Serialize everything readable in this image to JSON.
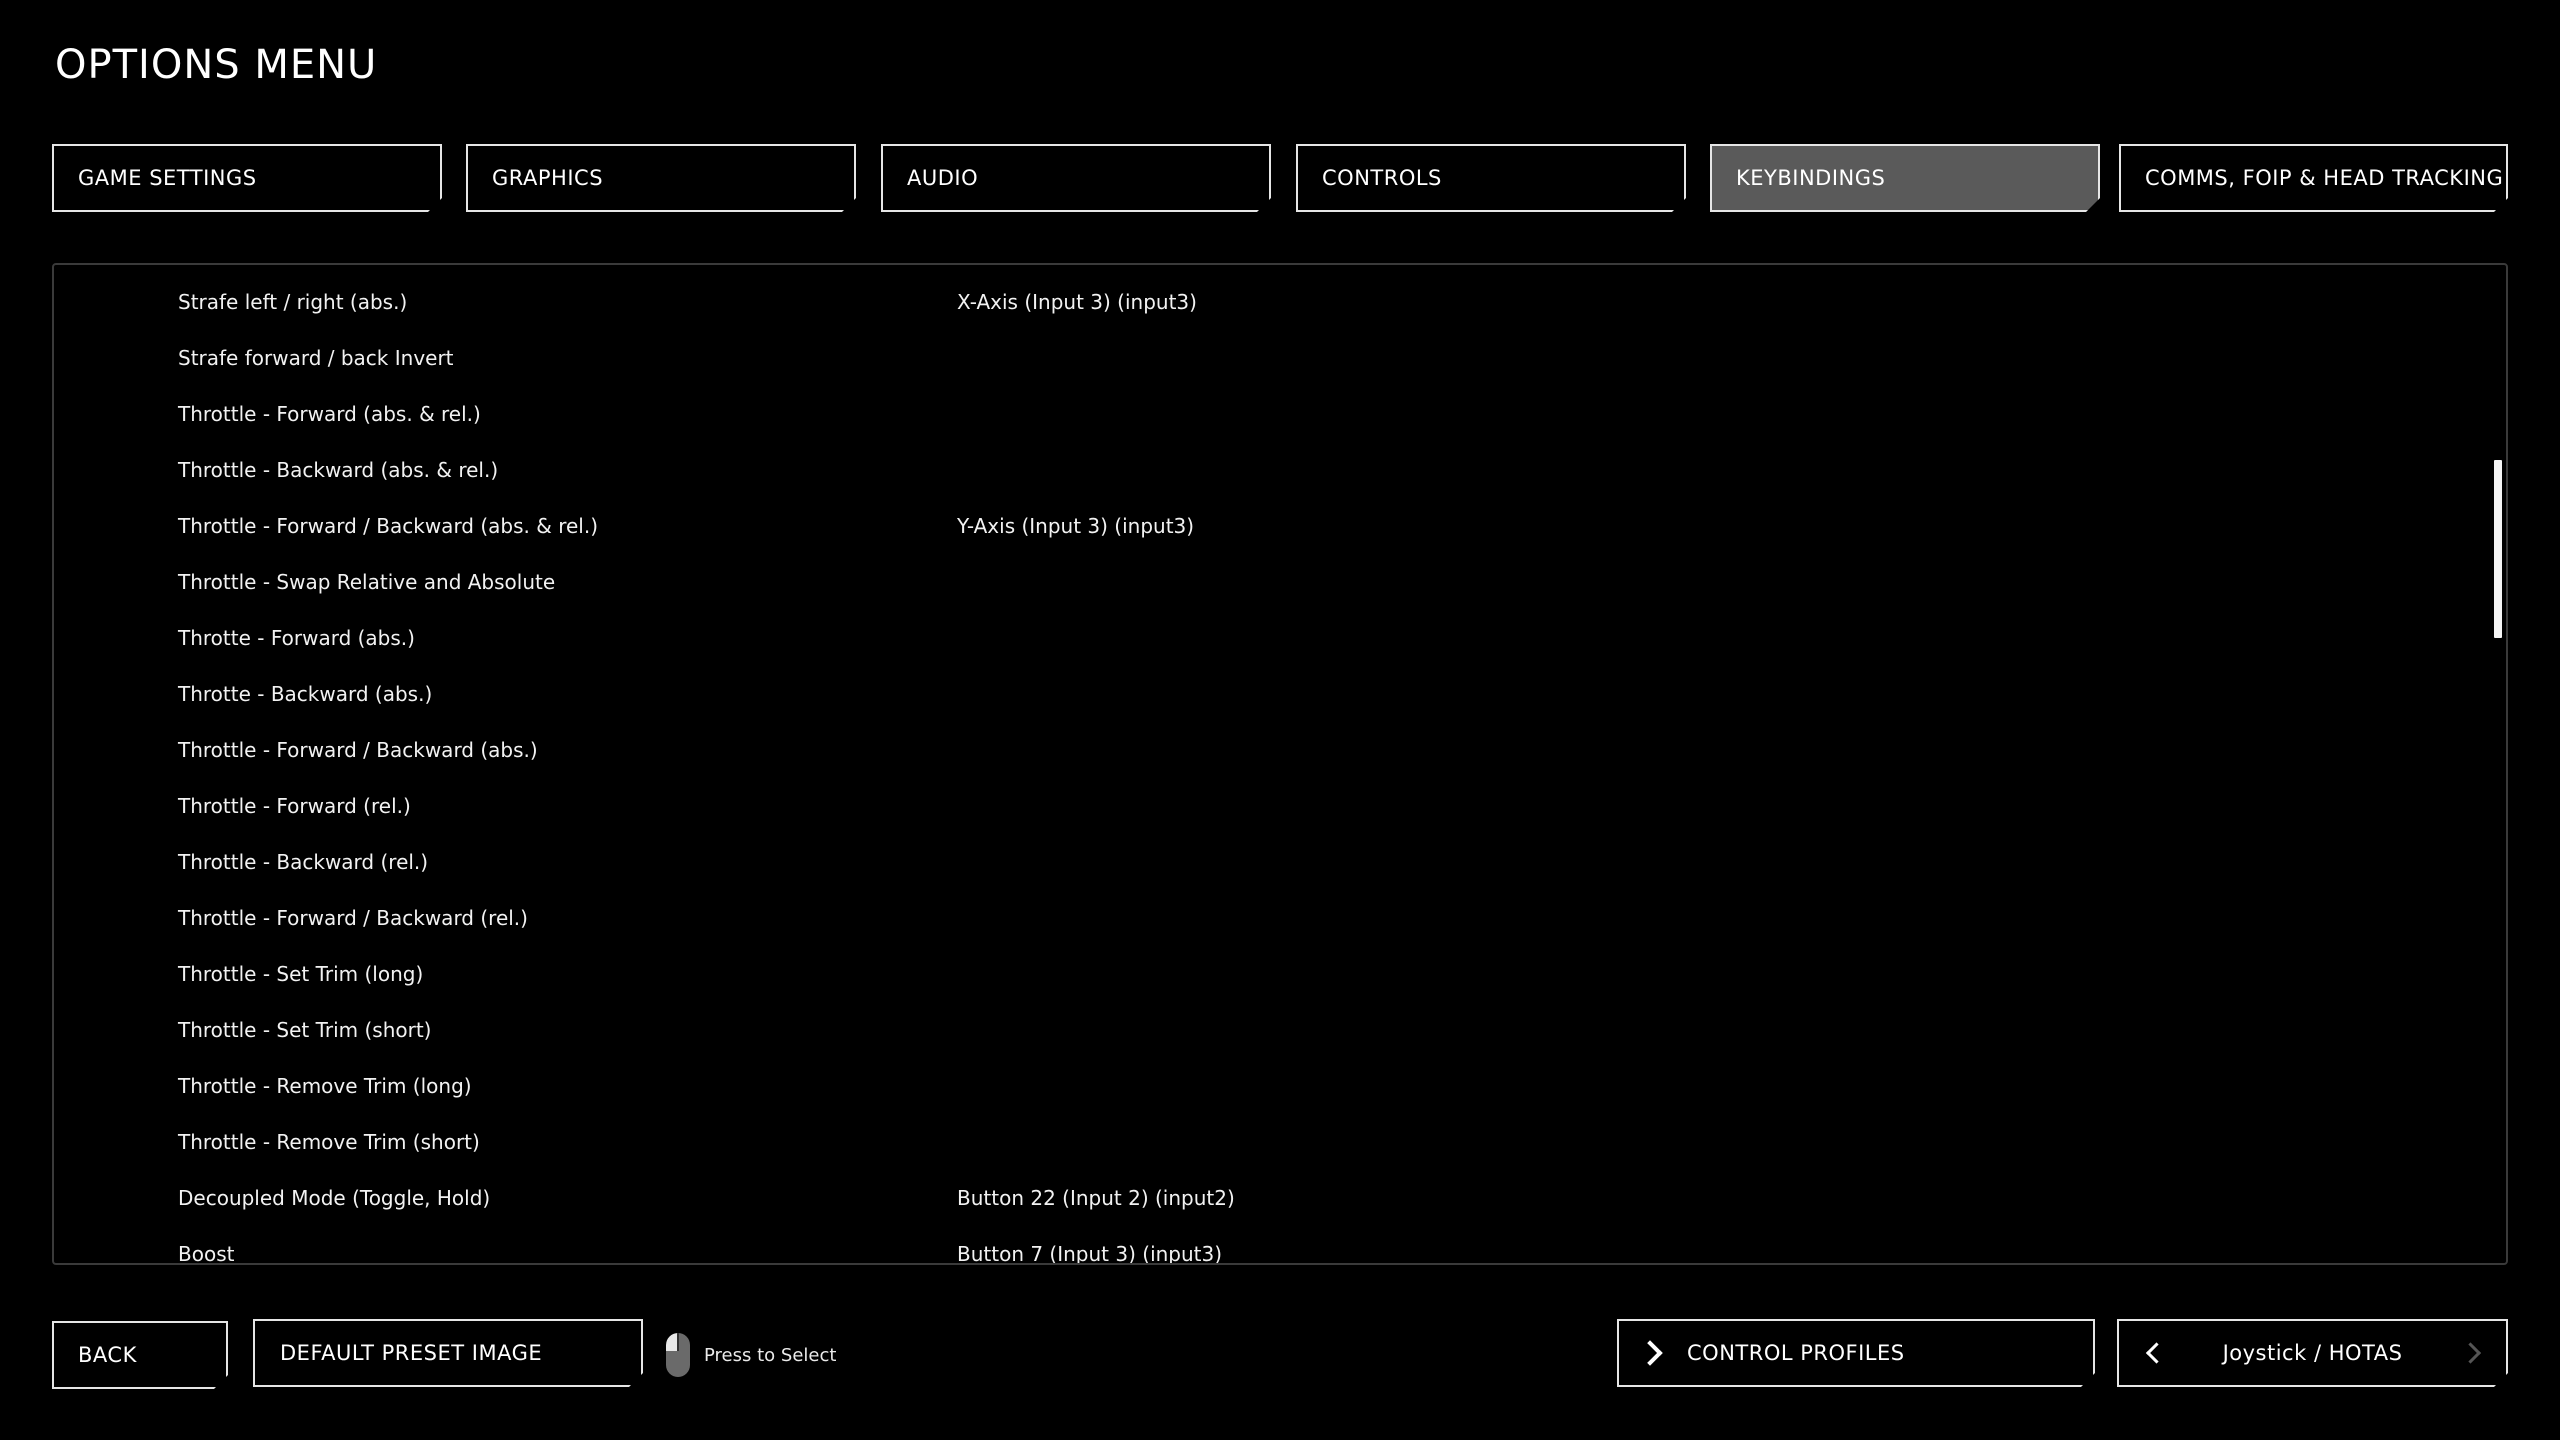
{
  "title": "OPTIONS MENU",
  "tabs": [
    {
      "label": "GAME SETTINGS",
      "active": false
    },
    {
      "label": "GRAPHICS",
      "active": false
    },
    {
      "label": "AUDIO",
      "active": false
    },
    {
      "label": "CONTROLS",
      "active": false
    },
    {
      "label": "KEYBINDINGS",
      "active": true
    },
    {
      "label": "COMMS, FOIP & HEAD TRACKING",
      "active": false
    }
  ],
  "bindings": [
    {
      "action": "Strafe left / right (abs.)",
      "binding": "X-Axis (Input 3) (input3)"
    },
    {
      "action": "Strafe forward / back Invert",
      "binding": ""
    },
    {
      "action": "Throttle - Forward (abs. & rel.)",
      "binding": ""
    },
    {
      "action": "Throttle - Backward (abs. & rel.)",
      "binding": ""
    },
    {
      "action": "Throttle - Forward / Backward (abs. & rel.)",
      "binding": "Y-Axis (Input 3) (input3)"
    },
    {
      "action": "Throttle - Swap Relative and Absolute",
      "binding": ""
    },
    {
      "action": "Throtte - Forward (abs.)",
      "binding": ""
    },
    {
      "action": "Throtte - Backward (abs.)",
      "binding": ""
    },
    {
      "action": "Throttle - Forward / Backward (abs.)",
      "binding": ""
    },
    {
      "action": "Throttle - Forward (rel.)",
      "binding": ""
    },
    {
      "action": "Throttle - Backward (rel.)",
      "binding": ""
    },
    {
      "action": "Throttle - Forward / Backward (rel.)",
      "binding": ""
    },
    {
      "action": "Throttle - Set Trim (long)",
      "binding": ""
    },
    {
      "action": "Throttle - Set Trim (short)",
      "binding": ""
    },
    {
      "action": "Throttle - Remove Trim (long)",
      "binding": ""
    },
    {
      "action": "Throttle - Remove Trim (short)",
      "binding": ""
    },
    {
      "action": "Decoupled Mode (Toggle, Hold)",
      "binding": "Button 22 (Input 2) (input2)"
    },
    {
      "action": "Boost",
      "binding": "Button 7 (Input 3) (input3)"
    }
  ],
  "footer": {
    "back_label": "BACK",
    "default_preset_label": "DEFAULT PRESET IMAGE",
    "hint_label": "Press to Select",
    "hint_icon": "mouse-left-click-icon",
    "control_profiles_label": "CONTROL PROFILES",
    "device_selector_value": "Joystick / HOTAS"
  }
}
